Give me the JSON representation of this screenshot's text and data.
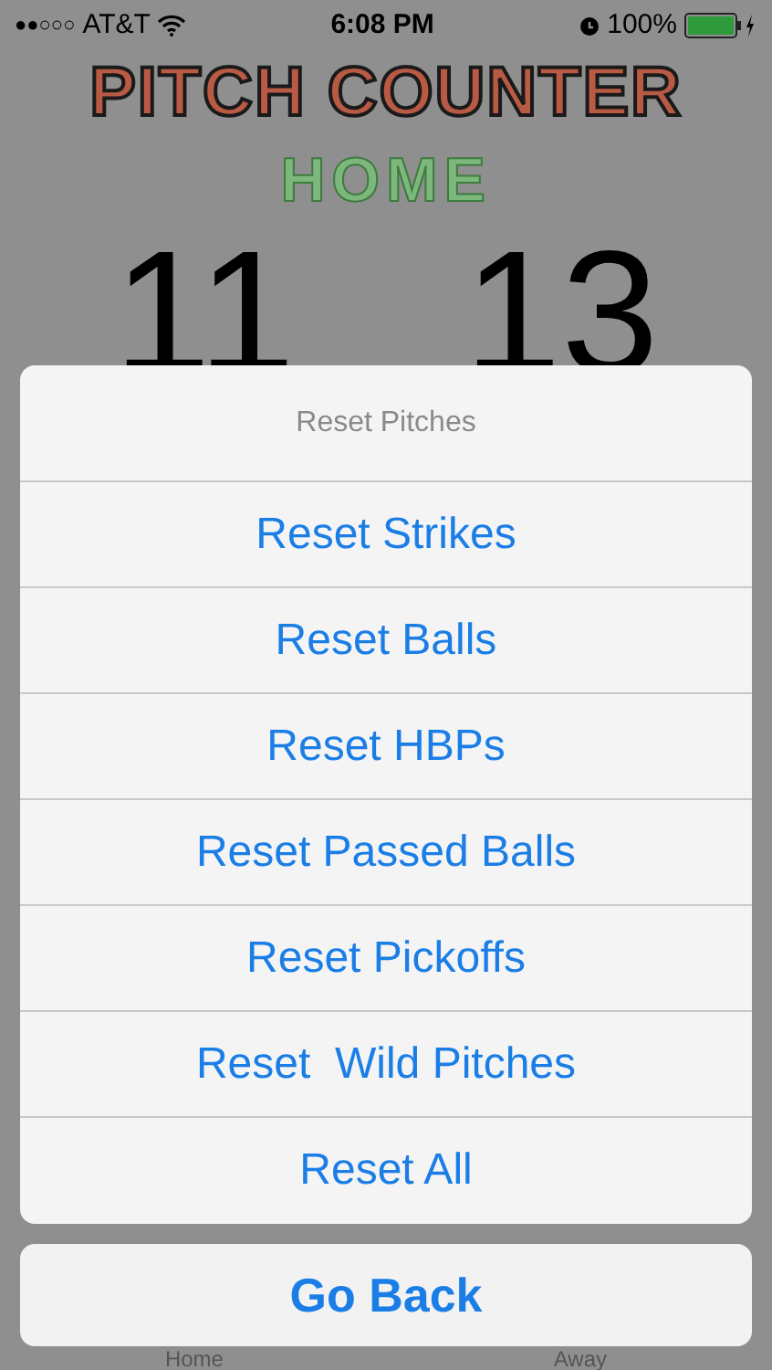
{
  "status_bar": {
    "signal": "●●○○○",
    "carrier": "AT&T",
    "time": "6:08 PM",
    "battery_percent": "100%"
  },
  "title": "PITCH COUNTER",
  "team": "HOME",
  "counts": [
    "11",
    "13"
  ],
  "tab_bar": [
    {
      "label": "Home"
    },
    {
      "label": "Away"
    }
  ],
  "action_sheet": {
    "title": "Reset Pitches",
    "actions": [
      "Reset Strikes",
      "Reset Balls",
      "Reset HBPs",
      "Reset Passed Balls",
      "Reset Pickoffs",
      "Reset  Wild Pitches",
      "Reset All"
    ],
    "cancel": "Go Back"
  }
}
